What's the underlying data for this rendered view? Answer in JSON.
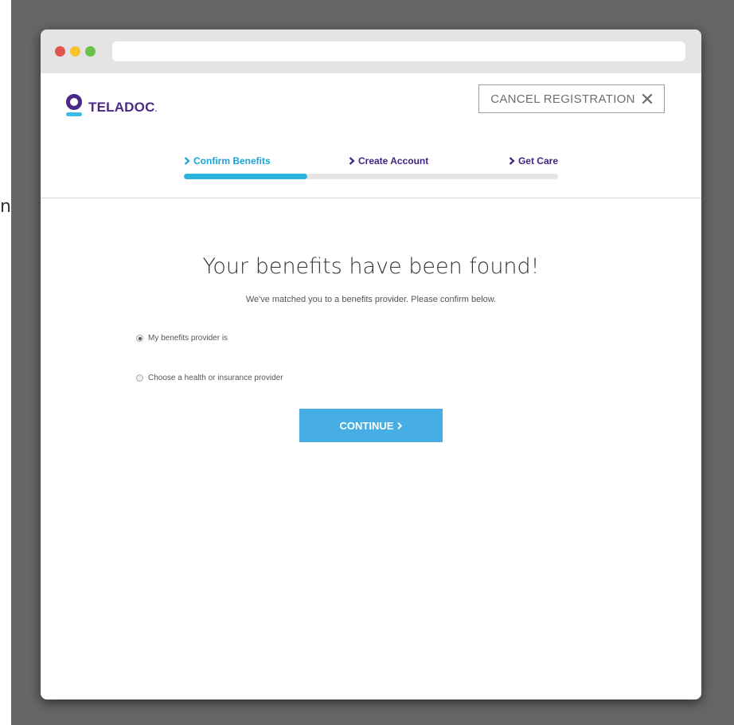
{
  "background": {
    "stray_char": "n"
  },
  "app": {
    "logo_text": "TELADOC",
    "logo_suffix": ".",
    "cancel_label": "CANCEL REGISTRATION",
    "close_icon": "close-icon"
  },
  "steps": [
    {
      "label": "Confirm Benefits",
      "active": true
    },
    {
      "label": "Create Account",
      "active": false
    },
    {
      "label": "Get Care",
      "active": false
    }
  ],
  "progress": {
    "fraction": 0.33
  },
  "main": {
    "heading": "Your benefits have been found!",
    "subheading": "We've matched you to a benefits provider. Please confirm below.",
    "options": [
      {
        "label": "My benefits provider is",
        "checked": true
      },
      {
        "label": "Choose a health or insurance provider",
        "checked": false
      }
    ],
    "continue_label": "CONTINUE"
  },
  "colors": {
    "brand_purple": "#4b2a87",
    "active_step": "#1aa3d6",
    "progress_fill": "#29b3de",
    "button_blue": "#46aee4",
    "backdrop": "#666666"
  }
}
